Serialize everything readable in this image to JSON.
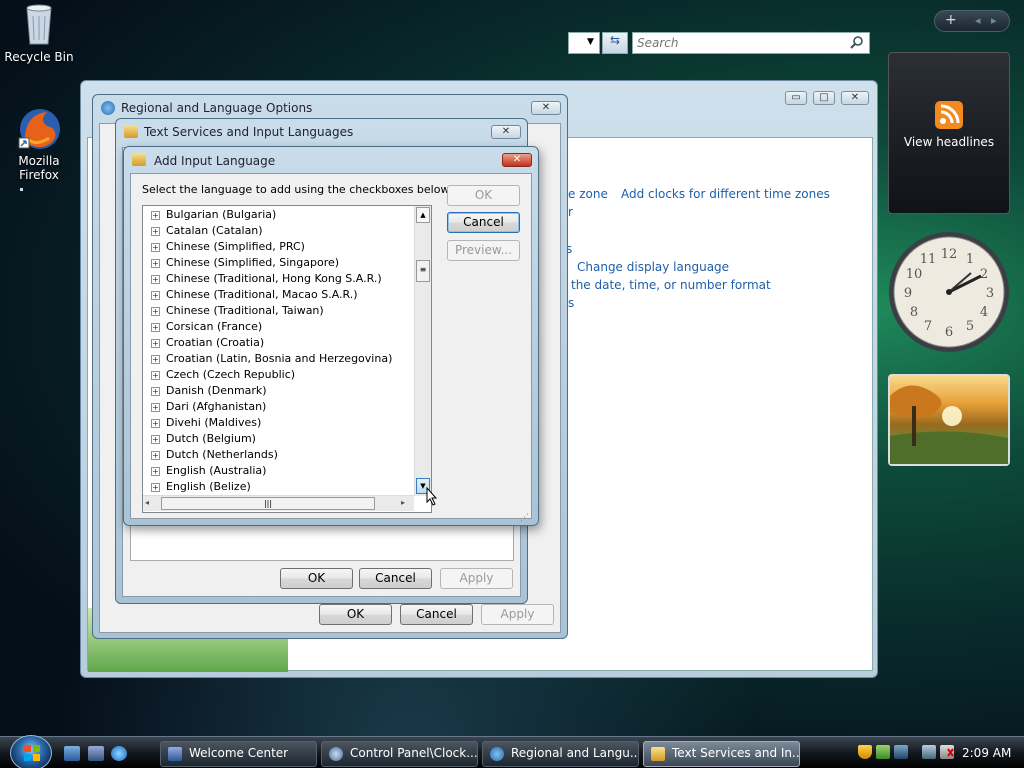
{
  "desktop": {
    "icons": [
      {
        "label": "Recycle Bin"
      },
      {
        "label": "Mozilla Firefox"
      }
    ]
  },
  "sidebar": {
    "controls": {
      "add": "+",
      "prev": "◂",
      "next": "▸"
    },
    "feeds_label": "View headlines"
  },
  "control_panel": {
    "search_placeholder": "Search",
    "links": [
      "e zone",
      "Add clocks for different time zones",
      "r",
      "s",
      "Change display language",
      "the date, time, or number format",
      "s"
    ],
    "window_controls": {
      "minimize": "▭",
      "maximize": "□",
      "close": "✕"
    }
  },
  "regional_dialog": {
    "title": "Regional and Language Options",
    "ok": "OK",
    "cancel": "Cancel",
    "apply": "Apply"
  },
  "text_services_dialog": {
    "title": "Text Services and Input Languages",
    "ok": "OK",
    "cancel": "Cancel",
    "apply": "Apply"
  },
  "add_language_dialog": {
    "title": "Add Input Language",
    "instruction": "Select the language to add using the checkboxes below.",
    "ok": "OK",
    "cancel": "Cancel",
    "preview": "Preview...",
    "close_glyph": "✕",
    "languages": [
      "Bulgarian (Bulgaria)",
      "Catalan (Catalan)",
      "Chinese (Simplified, PRC)",
      "Chinese (Simplified, Singapore)",
      "Chinese (Traditional, Hong Kong S.A.R.)",
      "Chinese (Traditional, Macao S.A.R.)",
      "Chinese (Traditional, Taiwan)",
      "Corsican (France)",
      "Croatian (Croatia)",
      "Croatian (Latin, Bosnia and Herzegovina)",
      "Czech (Czech Republic)",
      "Danish (Denmark)",
      "Dari (Afghanistan)",
      "Divehi (Maldives)",
      "Dutch (Belgium)",
      "Dutch (Netherlands)",
      "English (Australia)",
      "English (Belize)"
    ]
  },
  "taskbar": {
    "items": [
      {
        "label": "Welcome Center"
      },
      {
        "label": "Control Panel\\Clock..."
      },
      {
        "label": "Regional and Langu..."
      },
      {
        "label": "Text Services and In..."
      }
    ],
    "time": "2:09 AM"
  }
}
